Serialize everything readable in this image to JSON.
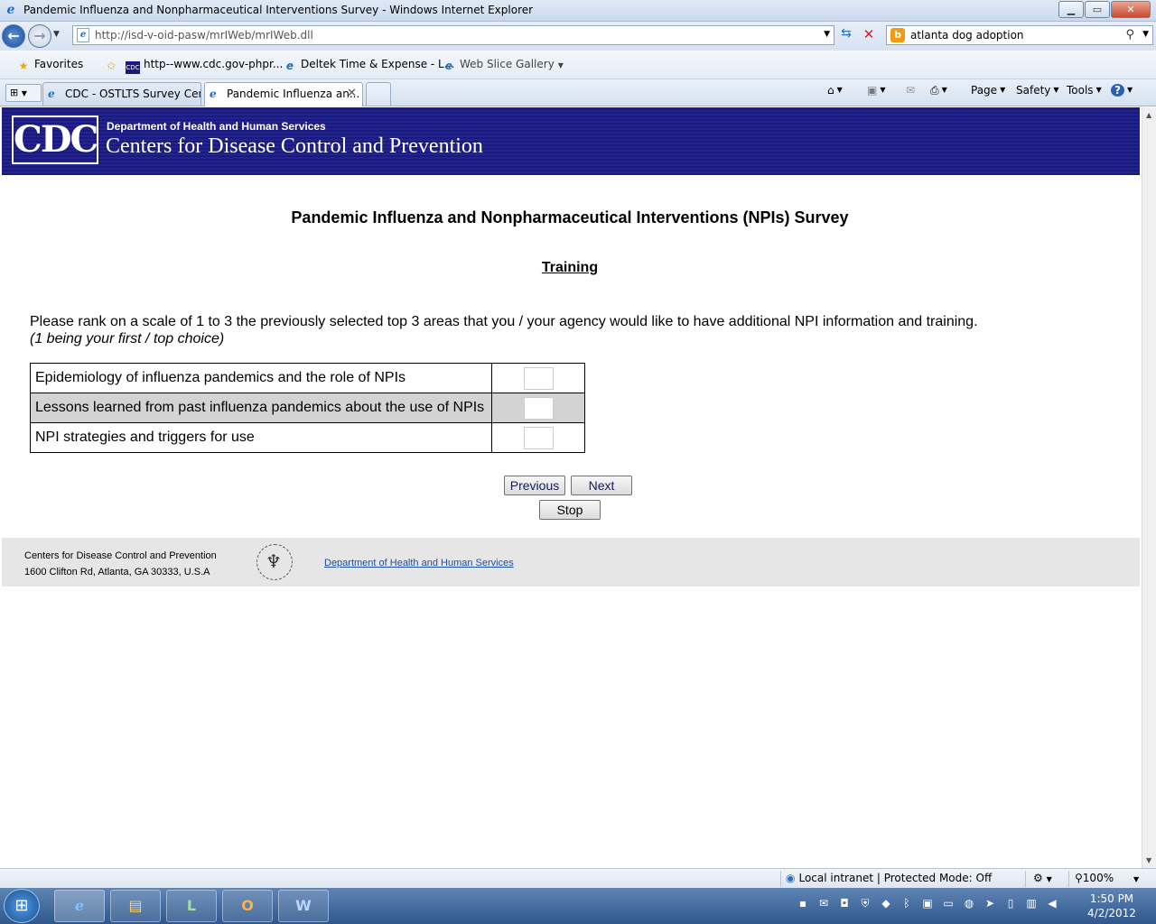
{
  "window": {
    "title": "Pandemic Influenza and Nonpharmaceutical Interventions Survey - Windows Internet Explorer",
    "min": "▁",
    "max": "▭",
    "close": "✕"
  },
  "address": {
    "url": "http://isd-v-oid-pasw/mrIWeb/mrIWeb.dll",
    "search_value": "atlanta dog adoption"
  },
  "favorites": {
    "label": "Favorites",
    "items": [
      "http--www.cdc.gov-phpr...",
      "Deltek Time & Expense - L...",
      "Web Slice Gallery"
    ]
  },
  "tabs": [
    {
      "label": "CDC - OSTLTS Survey Cen..."
    },
    {
      "label": "Pandemic Influenza an..."
    }
  ],
  "commands": {
    "page": "Page",
    "safety": "Safety",
    "tools": "Tools"
  },
  "header": {
    "logo": "CDC",
    "dept": "Department of Health and Human Services",
    "agency": "Centers for Disease Control and Prevention"
  },
  "survey": {
    "title": "Pandemic Influenza and Nonpharmaceutical Interventions (NPIs) Survey",
    "section": "Training",
    "instruction": "Please rank on a scale of 1 to 3 the previously selected top 3 areas that you / your agency would like to have additional NPI information and training.",
    "instruction_note": "(1 being your first / top choice)",
    "rows": [
      {
        "label": "Epidemiology of influenza pandemics and the role of NPIs",
        "value": ""
      },
      {
        "label": "Lessons learned from past influenza pandemics about the use of NPIs",
        "value": ""
      },
      {
        "label": "NPI strategies and triggers for use",
        "value": ""
      }
    ],
    "buttons": {
      "previous": "Previous",
      "next": "Next",
      "stop": "Stop"
    }
  },
  "footer": {
    "org_line1": "Centers for Disease Control and Prevention",
    "org_line2": "1600 Clifton Rd, Atlanta, GA 30333, U.S.A",
    "link": "Department of Health and Human Services"
  },
  "status": {
    "zone": "Local intranet | Protected Mode: Off",
    "zoom": "100%"
  },
  "taskbar": {
    "time": "1:50 PM",
    "date": "4/2/2012"
  }
}
